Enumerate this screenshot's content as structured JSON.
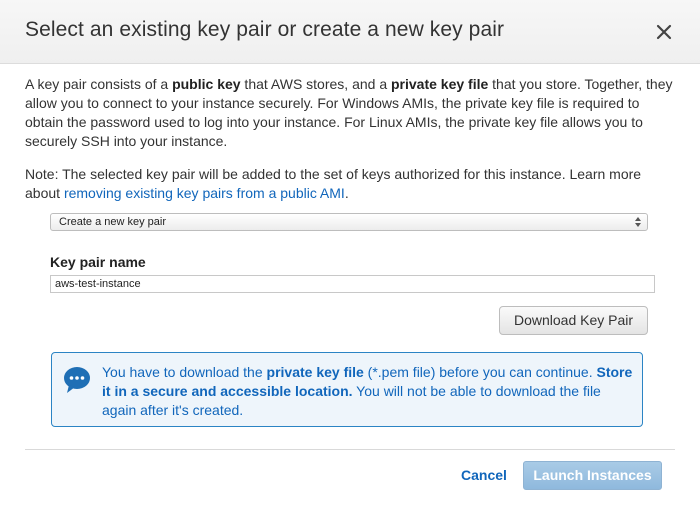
{
  "dialog": {
    "title": "Select an existing key pair or create a new key pair",
    "close_icon": "close-icon"
  },
  "intro": {
    "t1": "A key pair consists of a ",
    "b1": "public key",
    "t2": " that AWS stores, and a ",
    "b2": "private key file",
    "t3": " that you store. Together, they allow you to connect to your instance securely. For Windows AMIs, the private key file is required to obtain the password used to log into your instance. For Linux AMIs, the private key file allows you to securely SSH into your instance."
  },
  "note": {
    "text": "Note: The selected key pair will be added to the set of keys authorized for this instance. Learn more about ",
    "link": "removing existing key pairs from a public AMI",
    "end": "."
  },
  "select": {
    "value": "Create a new key pair",
    "arrow_icon": "select-arrows-icon"
  },
  "keypair": {
    "label": "Key pair name",
    "value": "aws-test-instance",
    "download_label": "Download Key Pair"
  },
  "info": {
    "icon": "chat-bubble-icon",
    "t1": "You have to download the ",
    "b1": "private key file",
    "t2": " (*.pem file) before you can continue. ",
    "b2": "Store it in a secure and accessible location.",
    "t3": " You will not be able to download the file again after it's created."
  },
  "footer": {
    "cancel": "Cancel",
    "launch": "Launch Instances"
  },
  "colors": {
    "link": "#1166bb",
    "info_border": "#2b84c4",
    "info_bg": "#eef5fb",
    "launch_disabled": "#9ec3e2"
  }
}
